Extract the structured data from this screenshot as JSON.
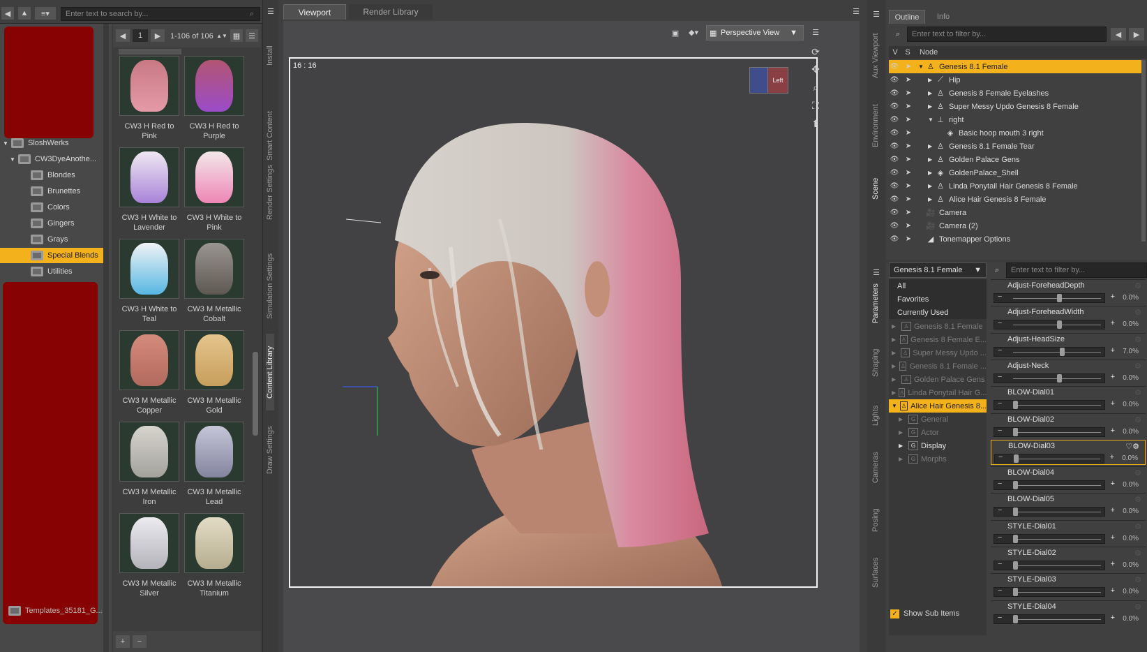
{
  "toolbar_left": {
    "search_placeholder": "Enter text to search by..."
  },
  "content_library": {
    "tree": [
      {
        "label": "SloshWerks",
        "expanded": true
      },
      {
        "label": "CW3DyeAnothe...",
        "expanded": true
      },
      {
        "label": "Blondes"
      },
      {
        "label": "Brunettes"
      },
      {
        "label": "Colors"
      },
      {
        "label": "Gingers"
      },
      {
        "label": "Grays"
      },
      {
        "label": "Special Blends",
        "selected": true
      },
      {
        "label": "Utilities"
      }
    ],
    "bottom_item": "Templates_35181_G...",
    "page": "1",
    "range": "1-106 of 106",
    "thumbnails": [
      {
        "label": "CW3 H Red to Pink",
        "colors": [
          "#c77a84",
          "#e59aa8"
        ]
      },
      {
        "label": "CW3 H Red to Purple",
        "colors": [
          "#b25572",
          "#9b4cc9"
        ]
      },
      {
        "label": "CW3 H White to Lavender",
        "colors": [
          "#efe8f2",
          "#a883d9"
        ]
      },
      {
        "label": "CW3 H White to Pink",
        "colors": [
          "#f2e8ea",
          "#ee86b5"
        ]
      },
      {
        "label": "CW3 H White to Teal",
        "colors": [
          "#f0f3f5",
          "#57b7e3"
        ]
      },
      {
        "label": "CW3 M Metallic Cobalt",
        "colors": [
          "#9b9591",
          "#5e5852"
        ]
      },
      {
        "label": "CW3 M Metallic Copper",
        "colors": [
          "#d58b7c",
          "#b26a5e"
        ]
      },
      {
        "label": "CW3 M Metallic Gold",
        "colors": [
          "#e5c58d",
          "#c79e5c"
        ]
      },
      {
        "label": "CW3 M Metallic Iron",
        "colors": [
          "#d6d4cd",
          "#a3a29b"
        ]
      },
      {
        "label": "CW3 M Metallic Lead",
        "colors": [
          "#c6c6d8",
          "#83849e"
        ]
      },
      {
        "label": "CW3 M Metallic Silver",
        "colors": [
          "#ecebf0",
          "#b4b3ba"
        ]
      },
      {
        "label": "CW3 M Metallic Titanium",
        "colors": [
          "#e3dcc5",
          "#b6ad90"
        ]
      }
    ]
  },
  "side_tabs_left": [
    "Install",
    "Smart Content",
    "Render Settings",
    "Simulation Settings",
    "Content Library",
    "Draw Settings"
  ],
  "viewport": {
    "tabs": [
      "Viewport",
      "Render Library"
    ],
    "view_select": "Perspective View",
    "aspect": "16 : 16",
    "cube_label": "Left"
  },
  "scene": {
    "tabs": [
      "Outline",
      "Info"
    ],
    "filter_placeholder": "Enter text to filter by...",
    "columns": [
      "V",
      "S",
      "Node"
    ],
    "nodes": [
      {
        "label": "Genesis 8.1 Female",
        "indent": 0,
        "selected": true,
        "icon": "figure"
      },
      {
        "label": "Hip",
        "indent": 1,
        "icon": "bone"
      },
      {
        "label": "Genesis 8 Female Eyelashes",
        "indent": 1,
        "icon": "figure"
      },
      {
        "label": "Super Messy Updo Genesis 8 Female",
        "indent": 1,
        "icon": "figure"
      },
      {
        "label": "right",
        "indent": 1,
        "icon": "null"
      },
      {
        "label": "Basic hoop mouth 3 right",
        "indent": 2,
        "icon": "prop"
      },
      {
        "label": "Genesis 8.1 Female Tear",
        "indent": 1,
        "icon": "figure"
      },
      {
        "label": "Golden Palace Gens",
        "indent": 1,
        "icon": "figure"
      },
      {
        "label": "GoldenPalace_Shell",
        "indent": 1,
        "icon": "prop"
      },
      {
        "label": "Linda Ponytail Hair Genesis 8 Female",
        "indent": 1,
        "icon": "figure"
      },
      {
        "label": "Alice Hair Genesis 8 Female",
        "indent": 1,
        "icon": "figure"
      },
      {
        "label": "Camera",
        "indent": 0,
        "icon": "camera"
      },
      {
        "label": "Camera (2)",
        "indent": 0,
        "icon": "camera"
      },
      {
        "label": "Tonemapper Options",
        "indent": 0,
        "icon": "tone"
      }
    ]
  },
  "side_tabs_right_top": [
    "Aux Viewport",
    "Environment",
    "Scene"
  ],
  "side_tabs_right_bottom": [
    "Parameters",
    "Shaping",
    "Lights",
    "Cameras",
    "Posing",
    "Surfaces"
  ],
  "parameters": {
    "figure_select": "Genesis 8.1 Female",
    "filter_placeholder": "Enter text to filter by...",
    "groups_top": [
      "All",
      "Favorites",
      "Currently Used"
    ],
    "groups": [
      {
        "label": "Genesis 8.1 Female",
        "dim": true
      },
      {
        "label": "Genesis 8 Female E...",
        "dim": true
      },
      {
        "label": "Super Messy Updo ...",
        "dim": true
      },
      {
        "label": "Genesis 8.1 Female ...",
        "dim": true
      },
      {
        "label": "Golden Palace Gens",
        "dim": true
      },
      {
        "label": "Linda Ponytail Hair G...",
        "dim": true
      },
      {
        "label": "Alice Hair Genesis 8...",
        "selected": true
      },
      {
        "label": "General",
        "sub": true,
        "dim": true
      },
      {
        "label": "Actor",
        "sub": true,
        "dim": true
      },
      {
        "label": "Display",
        "sub": true
      },
      {
        "label": "Morphs",
        "sub": true,
        "dim": true
      }
    ],
    "show_sub_items": "Show Sub Items",
    "items": [
      {
        "name": "Adjust-ForeheadDepth",
        "value": "0.0%",
        "pos": 0.5
      },
      {
        "name": "Adjust-ForeheadWidth",
        "value": "0.0%",
        "pos": 0.5
      },
      {
        "name": "Adjust-HeadSize",
        "value": "7.0%",
        "pos": 0.53
      },
      {
        "name": "Adjust-Neck",
        "value": "0.0%",
        "pos": 0.5
      },
      {
        "name": "BLOW-Dial01",
        "value": "0.0%",
        "pos": 0.0
      },
      {
        "name": "BLOW-Dial02",
        "value": "0.0%",
        "pos": 0.0
      },
      {
        "name": "BLOW-Dial03",
        "value": "0.0%",
        "pos": 0.0,
        "highlight": true
      },
      {
        "name": "BLOW-Dial04",
        "value": "0.0%",
        "pos": 0.0
      },
      {
        "name": "BLOW-Dial05",
        "value": "0.0%",
        "pos": 0.0
      },
      {
        "name": "STYLE-Dial01",
        "value": "0.0%",
        "pos": 0.0
      },
      {
        "name": "STYLE-Dial02",
        "value": "0.0%",
        "pos": 0.0
      },
      {
        "name": "STYLE-Dial03",
        "value": "0.0%",
        "pos": 0.0
      },
      {
        "name": "STYLE-Dial04",
        "value": "0.0%",
        "pos": 0.0
      }
    ]
  },
  "colors": {
    "accent": "#f3b21b",
    "panel": "#474747",
    "dark": "#2c2c2c",
    "viewport_bg": "#4a4a4c"
  }
}
